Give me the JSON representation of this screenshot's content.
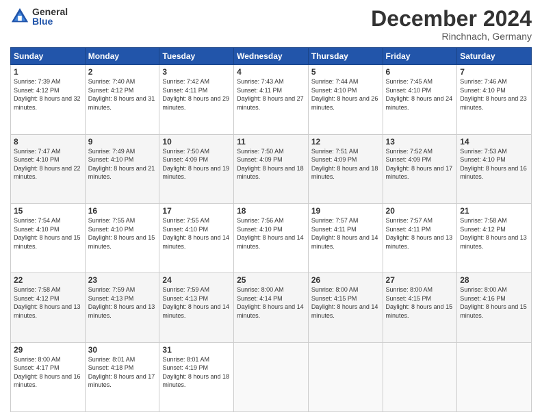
{
  "logo": {
    "general": "General",
    "blue": "Blue"
  },
  "title": "December 2024",
  "location": "Rinchnach, Germany",
  "days_header": [
    "Sunday",
    "Monday",
    "Tuesday",
    "Wednesday",
    "Thursday",
    "Friday",
    "Saturday"
  ],
  "weeks": [
    [
      {
        "day": "1",
        "sunrise": "Sunrise: 7:39 AM",
        "sunset": "Sunset: 4:12 PM",
        "daylight": "Daylight: 8 hours and 32 minutes."
      },
      {
        "day": "2",
        "sunrise": "Sunrise: 7:40 AM",
        "sunset": "Sunset: 4:12 PM",
        "daylight": "Daylight: 8 hours and 31 minutes."
      },
      {
        "day": "3",
        "sunrise": "Sunrise: 7:42 AM",
        "sunset": "Sunset: 4:11 PM",
        "daylight": "Daylight: 8 hours and 29 minutes."
      },
      {
        "day": "4",
        "sunrise": "Sunrise: 7:43 AM",
        "sunset": "Sunset: 4:11 PM",
        "daylight": "Daylight: 8 hours and 27 minutes."
      },
      {
        "day": "5",
        "sunrise": "Sunrise: 7:44 AM",
        "sunset": "Sunset: 4:10 PM",
        "daylight": "Daylight: 8 hours and 26 minutes."
      },
      {
        "day": "6",
        "sunrise": "Sunrise: 7:45 AM",
        "sunset": "Sunset: 4:10 PM",
        "daylight": "Daylight: 8 hours and 24 minutes."
      },
      {
        "day": "7",
        "sunrise": "Sunrise: 7:46 AM",
        "sunset": "Sunset: 4:10 PM",
        "daylight": "Daylight: 8 hours and 23 minutes."
      }
    ],
    [
      {
        "day": "8",
        "sunrise": "Sunrise: 7:47 AM",
        "sunset": "Sunset: 4:10 PM",
        "daylight": "Daylight: 8 hours and 22 minutes."
      },
      {
        "day": "9",
        "sunrise": "Sunrise: 7:49 AM",
        "sunset": "Sunset: 4:10 PM",
        "daylight": "Daylight: 8 hours and 21 minutes."
      },
      {
        "day": "10",
        "sunrise": "Sunrise: 7:50 AM",
        "sunset": "Sunset: 4:09 PM",
        "daylight": "Daylight: 8 hours and 19 minutes."
      },
      {
        "day": "11",
        "sunrise": "Sunrise: 7:50 AM",
        "sunset": "Sunset: 4:09 PM",
        "daylight": "Daylight: 8 hours and 18 minutes."
      },
      {
        "day": "12",
        "sunrise": "Sunrise: 7:51 AM",
        "sunset": "Sunset: 4:09 PM",
        "daylight": "Daylight: 8 hours and 18 minutes."
      },
      {
        "day": "13",
        "sunrise": "Sunrise: 7:52 AM",
        "sunset": "Sunset: 4:09 PM",
        "daylight": "Daylight: 8 hours and 17 minutes."
      },
      {
        "day": "14",
        "sunrise": "Sunrise: 7:53 AM",
        "sunset": "Sunset: 4:10 PM",
        "daylight": "Daylight: 8 hours and 16 minutes."
      }
    ],
    [
      {
        "day": "15",
        "sunrise": "Sunrise: 7:54 AM",
        "sunset": "Sunset: 4:10 PM",
        "daylight": "Daylight: 8 hours and 15 minutes."
      },
      {
        "day": "16",
        "sunrise": "Sunrise: 7:55 AM",
        "sunset": "Sunset: 4:10 PM",
        "daylight": "Daylight: 8 hours and 15 minutes."
      },
      {
        "day": "17",
        "sunrise": "Sunrise: 7:55 AM",
        "sunset": "Sunset: 4:10 PM",
        "daylight": "Daylight: 8 hours and 14 minutes."
      },
      {
        "day": "18",
        "sunrise": "Sunrise: 7:56 AM",
        "sunset": "Sunset: 4:10 PM",
        "daylight": "Daylight: 8 hours and 14 minutes."
      },
      {
        "day": "19",
        "sunrise": "Sunrise: 7:57 AM",
        "sunset": "Sunset: 4:11 PM",
        "daylight": "Daylight: 8 hours and 14 minutes."
      },
      {
        "day": "20",
        "sunrise": "Sunrise: 7:57 AM",
        "sunset": "Sunset: 4:11 PM",
        "daylight": "Daylight: 8 hours and 13 minutes."
      },
      {
        "day": "21",
        "sunrise": "Sunrise: 7:58 AM",
        "sunset": "Sunset: 4:12 PM",
        "daylight": "Daylight: 8 hours and 13 minutes."
      }
    ],
    [
      {
        "day": "22",
        "sunrise": "Sunrise: 7:58 AM",
        "sunset": "Sunset: 4:12 PM",
        "daylight": "Daylight: 8 hours and 13 minutes."
      },
      {
        "day": "23",
        "sunrise": "Sunrise: 7:59 AM",
        "sunset": "Sunset: 4:13 PM",
        "daylight": "Daylight: 8 hours and 13 minutes."
      },
      {
        "day": "24",
        "sunrise": "Sunrise: 7:59 AM",
        "sunset": "Sunset: 4:13 PM",
        "daylight": "Daylight: 8 hours and 14 minutes."
      },
      {
        "day": "25",
        "sunrise": "Sunrise: 8:00 AM",
        "sunset": "Sunset: 4:14 PM",
        "daylight": "Daylight: 8 hours and 14 minutes."
      },
      {
        "day": "26",
        "sunrise": "Sunrise: 8:00 AM",
        "sunset": "Sunset: 4:15 PM",
        "daylight": "Daylight: 8 hours and 14 minutes."
      },
      {
        "day": "27",
        "sunrise": "Sunrise: 8:00 AM",
        "sunset": "Sunset: 4:15 PM",
        "daylight": "Daylight: 8 hours and 15 minutes."
      },
      {
        "day": "28",
        "sunrise": "Sunrise: 8:00 AM",
        "sunset": "Sunset: 4:16 PM",
        "daylight": "Daylight: 8 hours and 15 minutes."
      }
    ],
    [
      {
        "day": "29",
        "sunrise": "Sunrise: 8:00 AM",
        "sunset": "Sunset: 4:17 PM",
        "daylight": "Daylight: 8 hours and 16 minutes."
      },
      {
        "day": "30",
        "sunrise": "Sunrise: 8:01 AM",
        "sunset": "Sunset: 4:18 PM",
        "daylight": "Daylight: 8 hours and 17 minutes."
      },
      {
        "day": "31",
        "sunrise": "Sunrise: 8:01 AM",
        "sunset": "Sunset: 4:19 PM",
        "daylight": "Daylight: 8 hours and 18 minutes."
      },
      null,
      null,
      null,
      null
    ]
  ]
}
